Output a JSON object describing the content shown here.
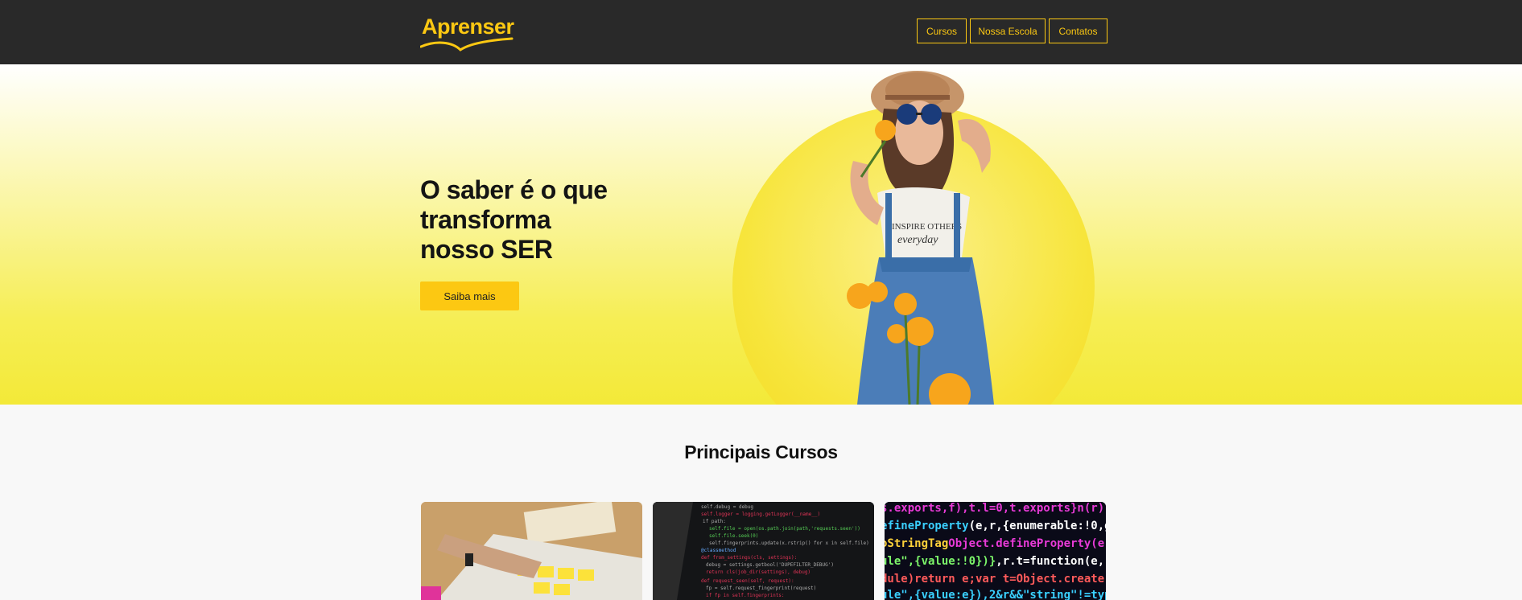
{
  "brand": {
    "logo_text": "Aprenser",
    "accent": "#fcc812",
    "header_bg": "#292929"
  },
  "nav": {
    "items": [
      {
        "label": "Cursos"
      },
      {
        "label": "Nossa Escola"
      },
      {
        "label": "Contatos"
      }
    ]
  },
  "hero": {
    "title_line1": "O saber é o que",
    "title_line2": "transforma",
    "title_line3": "nosso SER",
    "cta_label": "Saiba mais",
    "image": "woman-smelling-flower-photo"
  },
  "courses": {
    "title": "Principais Cursos",
    "cards": [
      {
        "image": "sticky-notes-planning-photo"
      },
      {
        "image": "python-code-screen-photo"
      },
      {
        "image": "colorful-javascript-code-photo"
      }
    ]
  }
}
